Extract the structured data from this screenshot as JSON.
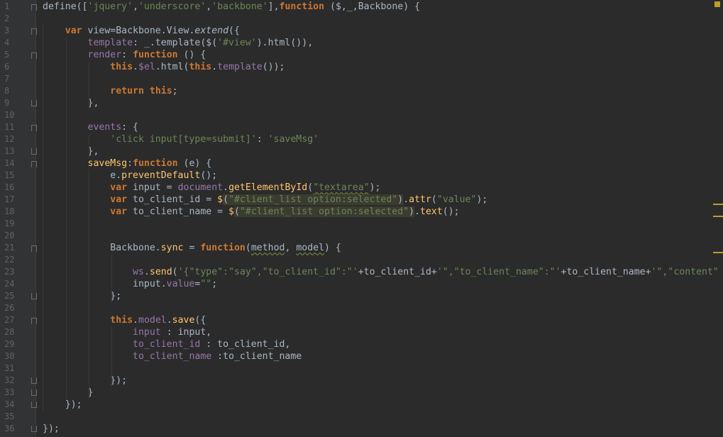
{
  "editor": {
    "language": "javascript",
    "line_numbers": [
      "1",
      "2",
      "3",
      "4",
      "5",
      "6",
      "7",
      "8",
      "9",
      "10",
      "11",
      "12",
      "13",
      "14",
      "15",
      "16",
      "17",
      "18",
      "19",
      "20",
      "21",
      "22",
      "23",
      "24",
      "25",
      "26",
      "27",
      "28",
      "29",
      "30",
      "31",
      "32",
      "33",
      "34",
      "35",
      "36"
    ],
    "lines": [
      [
        {
          "t": "define(["
        },
        {
          "t": "'jquery'",
          "c": "str"
        },
        {
          "t": ","
        },
        {
          "t": "'underscore'",
          "c": "str"
        },
        {
          "t": ","
        },
        {
          "t": "'backbone'",
          "c": "str"
        },
        {
          "t": "],"
        },
        {
          "t": "function",
          "c": "kw"
        },
        {
          "t": " ($,_,Backbone) {"
        }
      ],
      [],
      [
        {
          "t": "    "
        },
        {
          "t": "var",
          "c": "kw"
        },
        {
          "t": " view=Backbone.View."
        },
        {
          "t": "extend",
          "c": "it"
        },
        {
          "t": "({"
        }
      ],
      [
        {
          "t": "        "
        },
        {
          "t": "template",
          "c": "prop"
        },
        {
          "t": ": _.template($("
        },
        {
          "t": "'#view'",
          "c": "str"
        },
        {
          "t": ").html()),"
        }
      ],
      [
        {
          "t": "        "
        },
        {
          "t": "render",
          "c": "prop"
        },
        {
          "t": ": "
        },
        {
          "t": "function",
          "c": "kw"
        },
        {
          "t": " () {"
        }
      ],
      [
        {
          "t": "            "
        },
        {
          "t": "this",
          "c": "kw"
        },
        {
          "t": "."
        },
        {
          "t": "$el",
          "c": "prop"
        },
        {
          "t": ".html("
        },
        {
          "t": "this",
          "c": "kw"
        },
        {
          "t": "."
        },
        {
          "t": "template",
          "c": "prop"
        },
        {
          "t": "());"
        }
      ],
      [],
      [
        {
          "t": "            "
        },
        {
          "t": "return",
          "c": "kw"
        },
        {
          "t": " "
        },
        {
          "t": "this",
          "c": "kw"
        },
        {
          "t": ";"
        }
      ],
      [
        {
          "t": "        },"
        }
      ],
      [],
      [
        {
          "t": "        "
        },
        {
          "t": "events",
          "c": "prop"
        },
        {
          "t": ": {"
        }
      ],
      [
        {
          "t": "            "
        },
        {
          "t": "'click input[type=submit]'",
          "c": "str"
        },
        {
          "t": ": "
        },
        {
          "t": "'saveMsg'",
          "c": "str"
        }
      ],
      [
        {
          "t": "        },"
        }
      ],
      [
        {
          "t": "        "
        },
        {
          "t": "saveMsg",
          "c": "fn"
        },
        {
          "t": ":"
        },
        {
          "t": "function",
          "c": "kw"
        },
        {
          "t": " (e) {"
        }
      ],
      [
        {
          "t": "            e."
        },
        {
          "t": "preventDefault",
          "c": "fn"
        },
        {
          "t": "();"
        }
      ],
      [
        {
          "t": "            "
        },
        {
          "t": "var",
          "c": "kw"
        },
        {
          "t": " input = "
        },
        {
          "t": "document",
          "c": "prop"
        },
        {
          "t": "."
        },
        {
          "t": "getElementById",
          "c": "fn"
        },
        {
          "t": "("
        },
        {
          "t": "\"textarea\"",
          "c": "str uw"
        },
        {
          "t": ");"
        }
      ],
      [
        {
          "t": "            "
        },
        {
          "t": "var",
          "c": "kw"
        },
        {
          "t": " to_client_id = "
        },
        {
          "t": "$",
          "c": "fn"
        },
        {
          "t": "(",
          "c": "hl"
        },
        {
          "t": "\"#client_list option:selected\"",
          "c": "str hl"
        },
        {
          "t": ")",
          "c": "hl"
        },
        {
          "t": "."
        },
        {
          "t": "attr",
          "c": "fn"
        },
        {
          "t": "("
        },
        {
          "t": "\"value\"",
          "c": "str"
        },
        {
          "t": ");"
        }
      ],
      [
        {
          "t": "            "
        },
        {
          "t": "var",
          "c": "kw"
        },
        {
          "t": " to_client_name = "
        },
        {
          "t": "$",
          "c": "fn"
        },
        {
          "t": "(",
          "c": "hl"
        },
        {
          "t": "\"#client_list option:selected\"",
          "c": "str hl"
        },
        {
          "t": ")",
          "c": "hl"
        },
        {
          "t": "."
        },
        {
          "t": "text",
          "c": "fn"
        },
        {
          "t": "();"
        }
      ],
      [],
      [],
      [
        {
          "t": "            Backbone."
        },
        {
          "t": "sync",
          "c": "fn"
        },
        {
          "t": " = "
        },
        {
          "t": "function",
          "c": "kw"
        },
        {
          "t": "("
        },
        {
          "t": "method",
          "c": "uw"
        },
        {
          "t": ", "
        },
        {
          "t": "model",
          "c": "uw"
        },
        {
          "t": ") {"
        }
      ],
      [],
      [
        {
          "t": "                "
        },
        {
          "t": "ws",
          "c": "prop"
        },
        {
          "t": "."
        },
        {
          "t": "send",
          "c": "fn"
        },
        {
          "t": "("
        },
        {
          "t": "'{\"type\":\"say\",\"to_client_id\":\"'",
          "c": "str"
        },
        {
          "t": "+to_client_id+"
        },
        {
          "t": "'\",\"to_client_name\":\"'",
          "c": "str"
        },
        {
          "t": "+to_client_name+"
        },
        {
          "t": "'\",\"content\"",
          "c": "str"
        }
      ],
      [
        {
          "t": "                input."
        },
        {
          "t": "value",
          "c": "prop"
        },
        {
          "t": "="
        },
        {
          "t": "\"\"",
          "c": "str"
        },
        {
          "t": ";"
        }
      ],
      [
        {
          "t": "            };"
        }
      ],
      [],
      [
        {
          "t": "            "
        },
        {
          "t": "this",
          "c": "kw"
        },
        {
          "t": "."
        },
        {
          "t": "model",
          "c": "prop"
        },
        {
          "t": "."
        },
        {
          "t": "save",
          "c": "fn"
        },
        {
          "t": "({"
        }
      ],
      [
        {
          "t": "                "
        },
        {
          "t": "input",
          "c": "prop"
        },
        {
          "t": " : input,"
        }
      ],
      [
        {
          "t": "                "
        },
        {
          "t": "to_client_id",
          "c": "prop"
        },
        {
          "t": " : to_client_id,"
        }
      ],
      [
        {
          "t": "                "
        },
        {
          "t": "to_client_name",
          "c": "prop"
        },
        {
          "t": " :to_client_name"
        }
      ],
      [],
      [
        {
          "t": "            });"
        }
      ],
      [
        {
          "t": "        }"
        }
      ],
      [
        {
          "t": "    });"
        }
      ],
      [],
      [
        {
          "t": "});"
        }
      ]
    ]
  },
  "colors": {
    "background": "#2b2b2b",
    "gutter": "#313335",
    "keyword": "#cc7832",
    "string": "#6a8759",
    "property": "#9876aa",
    "function": "#ffc66d",
    "text": "#a9b7c6",
    "marker": "#bb9e2e"
  }
}
